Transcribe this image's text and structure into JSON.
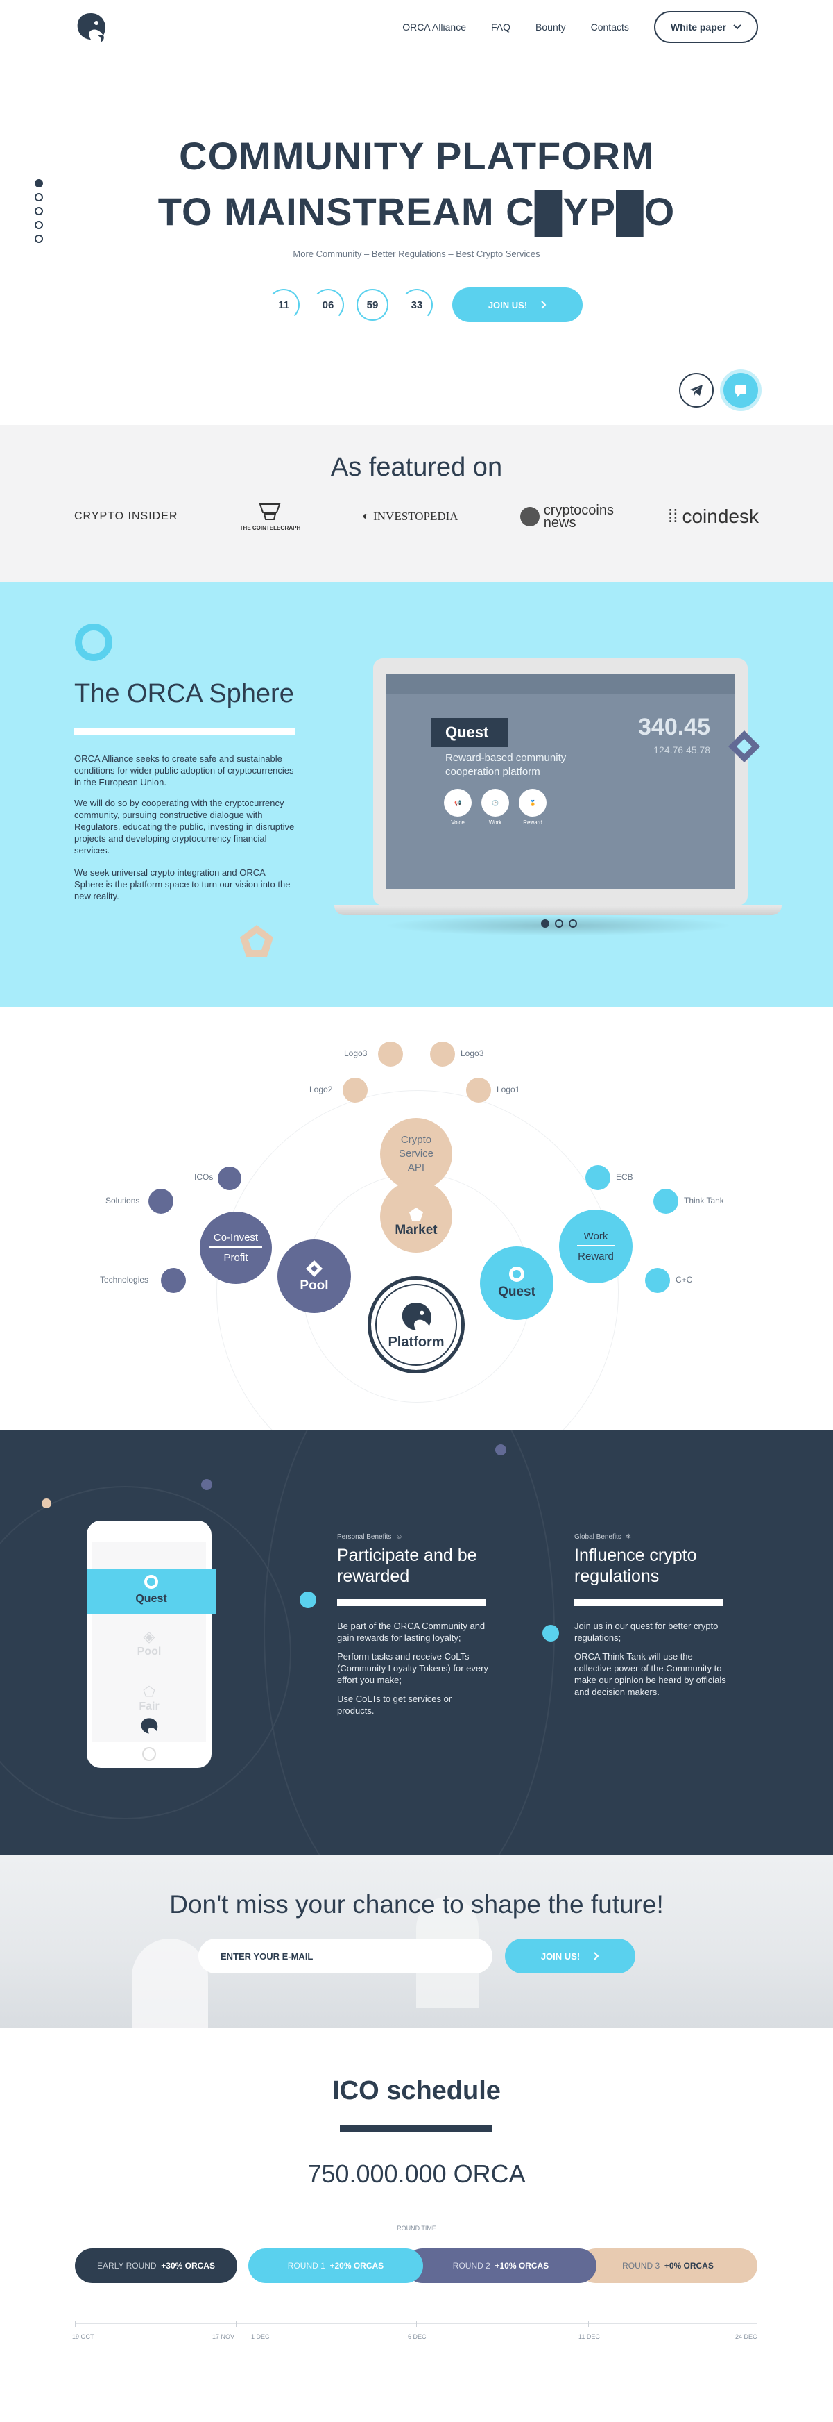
{
  "header": {
    "nav": [
      "ORCA Alliance",
      "FAQ",
      "Bounty",
      "Contacts"
    ],
    "white_paper": "White paper"
  },
  "hero": {
    "title_line1": "COMMUNITY PLATFORM",
    "title_line2": "TO MAINSTREAM  C█YP█O",
    "subtitle": "More Community – Better Regulations – Best Crypto Services",
    "countdown": [
      "11",
      "06",
      "59",
      "33"
    ],
    "join": "JOIN US!"
  },
  "featured": {
    "title": "As featured on",
    "logos": [
      "CRYPTO INSIDER",
      "THE COINTELEGRAPH",
      "INVESTOPEDIA",
      "cryptocoins news",
      "coindesk"
    ]
  },
  "sphere": {
    "title": "The ORCA Sphere",
    "p1": "ORCA Alliance seeks to create safe and sustainable conditions for wider public adoption of cryptocurrencies in the European Union.",
    "p2": "We will do so by cooperating with the cryptocurrency community, pursuing constructive dialogue with Regulators, educating the public, investing in disruptive projects and developing cryptocurrency financial services.",
    "p3": "We seek universal crypto integration and ORCA Sphere is the platform space to turn our vision into the new reality.",
    "screen": {
      "quest": "Quest",
      "desc": "Reward-based community cooperation platform",
      "icons": [
        "Voice",
        "Work",
        "Reward"
      ],
      "price": "340.45",
      "price_sub": "124.76   45.78"
    }
  },
  "ecosystem": {
    "logos": [
      "Logo3",
      "Logo3",
      "Logo2",
      "Logo1"
    ],
    "crypto_api": "Crypto Service API",
    "market": "Market",
    "pool": "Pool",
    "quest": "Quest",
    "platform": "Platform",
    "coinvest": "Co-Invest",
    "profit": "Profit",
    "work": "Work",
    "reward": "Reward",
    "left_labels": [
      "ICOs",
      "Solutions",
      "Technologies"
    ],
    "right_labels": [
      "ECB",
      "Think Tank",
      "C+C"
    ]
  },
  "benefits": {
    "phone": {
      "quest": "Quest",
      "pool": "Pool",
      "fair": "Fair"
    },
    "personal": {
      "tag": "Personal Benefits",
      "title": "Participate and be rewarded",
      "p1": "Be part of the ORCA Community and gain rewards for lasting loyalty;",
      "p2": "Perform tasks and receive CoLTs (Community Loyalty Tokens) for every effort you make;",
      "p3": "Use CoLTs to get services or products."
    },
    "global": {
      "tag": "Global Benefits",
      "title": "Influence crypto regulations",
      "p1": "Join us in our quest for better crypto regulations;",
      "p2": "ORCA Think Tank will use the collective power of the Community to make our opinion be heard by officials and decision makers."
    }
  },
  "cta": {
    "title": "Don't miss your chance to shape the future!",
    "placeholder": "ENTER YOUR E-MAIL",
    "join": "JOIN US!"
  },
  "schedule": {
    "title": "ICO schedule",
    "total": "750.000.000 ORCA",
    "round_time": "ROUND TIME",
    "rounds": [
      {
        "name": "EARLY ROUND",
        "bonus": "+30% ORCAS",
        "color": "#2e3e50"
      },
      {
        "name": "ROUND 1",
        "bonus": "+20% ORCAS",
        "color": "#5ad1ee"
      },
      {
        "name": "ROUND 2",
        "bonus": "+10% ORCAS",
        "color": "#626a95"
      },
      {
        "name": "ROUND 3",
        "bonus": "+0% ORCAS",
        "color": "#e8cbb1"
      }
    ],
    "dates": [
      "19 OCT",
      "17 NOV",
      "1 DEC",
      "6 DEC",
      "11 DEC",
      "24 DEC"
    ]
  }
}
